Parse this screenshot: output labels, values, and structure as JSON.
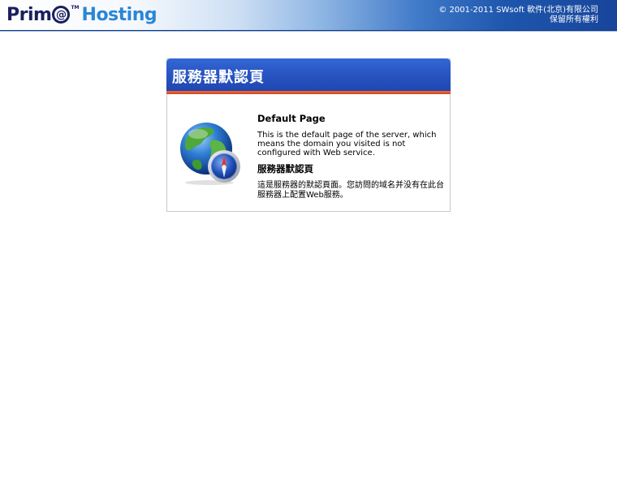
{
  "header": {
    "logo_prim": "Prim",
    "logo_at": "@",
    "logo_tm": "TM",
    "logo_hosting": "Hosting",
    "copyright_line1": "© 2001-2011 SWsoft 軟件(北京)有限公司",
    "copyright_line2": "保留所有權利"
  },
  "card": {
    "header_title": "服務器默認頁",
    "heading_en": "Default Page",
    "text_en": "This is the default page of the server, which means the domain you visited is not configured with Web service.",
    "heading_cn": "服務器默認頁",
    "text_cn": "這是服務器的默認頁面。您訪問的域名并没有在此台服務器上配置Web服務。",
    "globe_icon": "globe-compass-icon"
  },
  "colors": {
    "card_header_blue": "#2a58c6",
    "card_rule_orange": "#e0532a",
    "header_dark_blue": "#17459b"
  }
}
